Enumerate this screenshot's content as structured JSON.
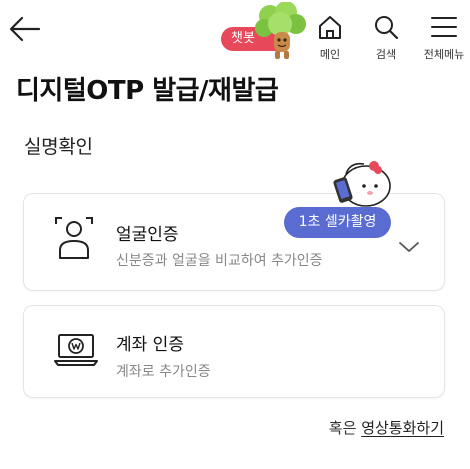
{
  "header": {
    "chatbot_label": "챗봇",
    "nav": {
      "home_label": "메인",
      "search_label": "검색",
      "menu_label": "전체메뉴"
    }
  },
  "page_title": "디지털OTP 발급/재발급",
  "section_title": "실명확인",
  "methods": {
    "face": {
      "title": "얼굴인증",
      "description": "신분증과 얼굴을 비교하여 추가인증",
      "badge": "1초 셀카촬영"
    },
    "account": {
      "title": "계좌 인증",
      "description": "계좌로 추가인증"
    }
  },
  "alternative": {
    "prefix": "혹은",
    "link": "영상통화하기"
  },
  "colors": {
    "chatbot_bg": "#e8495a",
    "badge_bg": "#5a6cd2",
    "text": "#111111",
    "muted": "#888888"
  }
}
